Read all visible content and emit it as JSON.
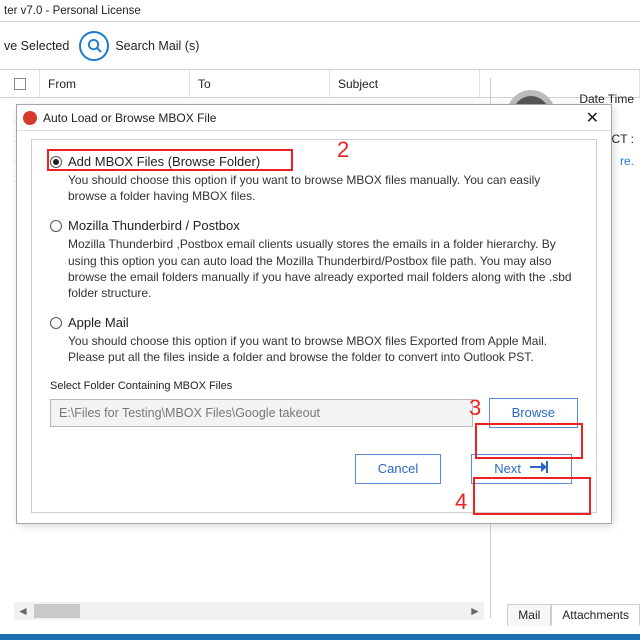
{
  "app": {
    "title": "ter v7.0 - Personal License"
  },
  "toolbar": {
    "remove_selected": "ve Selected",
    "search_mail": "Search Mail (s)"
  },
  "grid": {
    "from": "From",
    "to": "To",
    "subject": "Subject"
  },
  "right": {
    "date_time": "Date Time",
    "ct_suffix": "CT :",
    "link_suffix": "re."
  },
  "dialog": {
    "title": "Auto Load or Browse MBOX File",
    "opt1": {
      "label": "Add MBOX Files (Browse Folder)",
      "desc": "You should choose this option if you want to browse MBOX files manually. You can easily browse a folder having MBOX files."
    },
    "opt2": {
      "label": "Mozilla Thunderbird / Postbox",
      "desc": "Mozilla Thunderbird ,Postbox email clients usually stores the emails in a folder hierarchy. By using this option you can auto load the Mozilla Thunderbird/Postbox file path. You may also browse the email folders manually if you have already exported mail folders along with the .sbd folder structure."
    },
    "opt3": {
      "label": "Apple Mail",
      "desc": "You should choose this option if you want to browse MBOX files Exported from Apple Mail. Please put all the files inside a folder and browse the folder to convert into  Outlook PST."
    },
    "field_label": "Select Folder Containing MBOX Files",
    "path_value": "E:\\Files for Testing\\MBOX Files\\Google takeout",
    "browse": "Browse",
    "cancel": "Cancel",
    "next": "Next"
  },
  "tabs": {
    "mail": "Mail",
    "attachments": "Attachments"
  },
  "callouts": {
    "n2": "2",
    "n3": "3",
    "n4": "4"
  }
}
